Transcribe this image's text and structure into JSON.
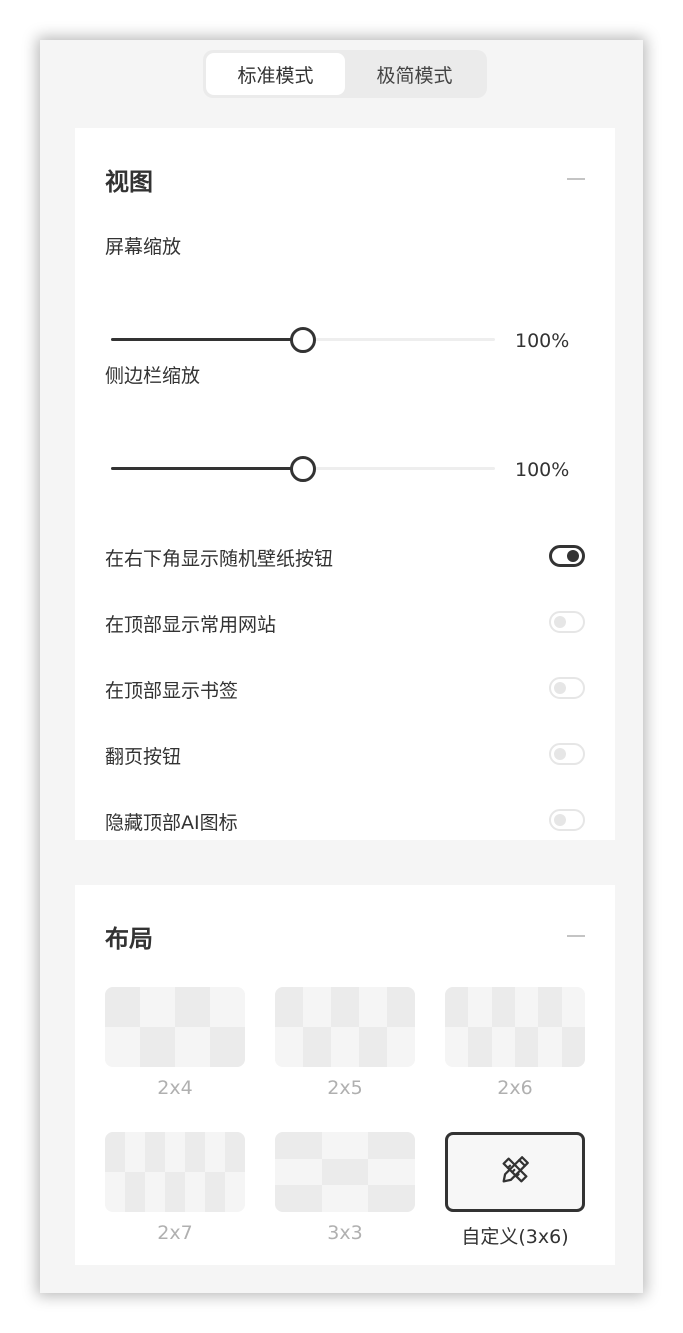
{
  "mode_tabs": [
    {
      "label": "标准模式",
      "active": true
    },
    {
      "label": "极简模式",
      "active": false
    }
  ],
  "view": {
    "title": "视图",
    "screen_zoom": {
      "label": "屏幕缩放",
      "value_text": "100%",
      "level": 0.5
    },
    "sidebar_zoom": {
      "label": "侧边栏缩放",
      "value_text": "100%",
      "level": 0.5
    },
    "toggles": [
      {
        "label": "在右下角显示随机壁纸按钮",
        "on": true
      },
      {
        "label": "在顶部显示常用网站",
        "on": false
      },
      {
        "label": "在顶部显示书签",
        "on": false
      },
      {
        "label": "翻页按钮",
        "on": false
      },
      {
        "label": "隐藏顶部AI图标",
        "on": false
      }
    ]
  },
  "layout": {
    "title": "布局",
    "options": [
      {
        "label": "2x4",
        "rows": 2,
        "cols": 4
      },
      {
        "label": "2x5",
        "rows": 2,
        "cols": 5
      },
      {
        "label": "2x6",
        "rows": 2,
        "cols": 6
      },
      {
        "label": "2x7",
        "rows": 2,
        "cols": 7
      },
      {
        "label": "3x3",
        "rows": 3,
        "cols": 3
      },
      {
        "label": "自定义(3x6)",
        "custom": true,
        "icon": "pencil-ruler-icon"
      }
    ]
  },
  "colors": {
    "accent": "#333333",
    "track": "#eeeeee",
    "background": "#f5f5f5"
  }
}
